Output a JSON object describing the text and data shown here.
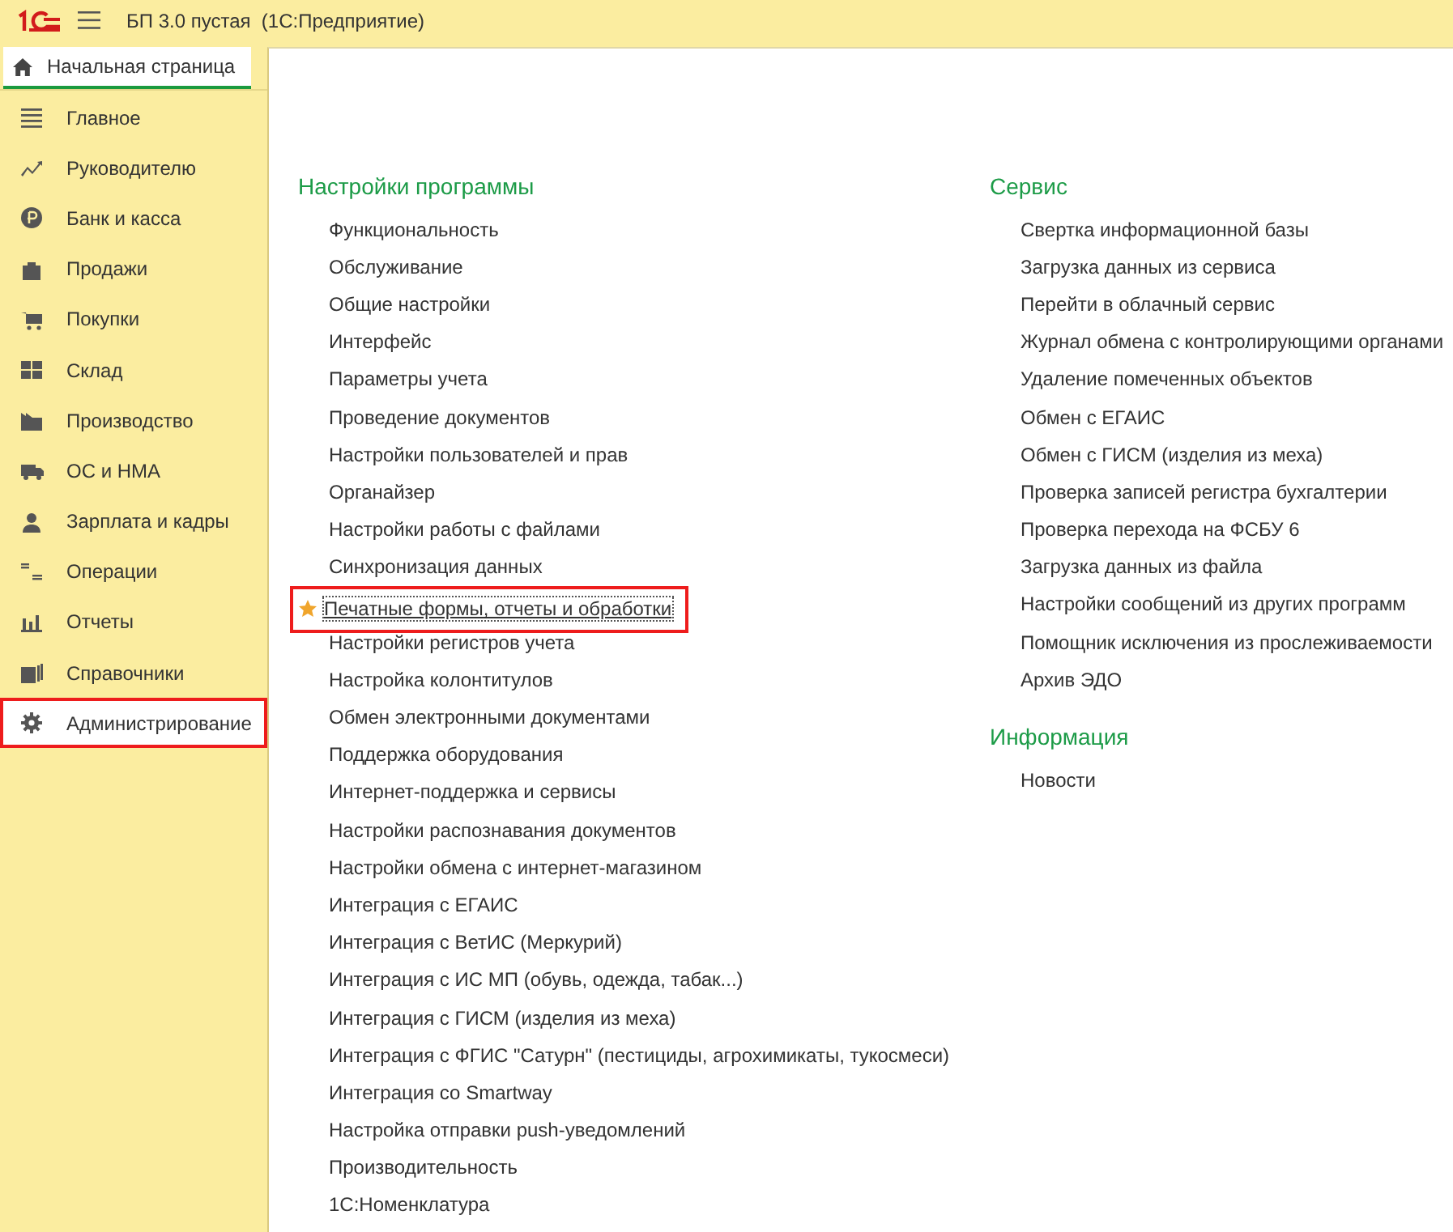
{
  "window": {
    "title": "БП 3.0 пустая  (1С:Предприятие)"
  },
  "tabs": [
    {
      "label": "Начальная страница",
      "selected": true
    }
  ],
  "sidebar": {
    "items": [
      {
        "label": "Главное",
        "selected": false,
        "highlighted": false
      },
      {
        "label": "Руководителю",
        "selected": false,
        "highlighted": false
      },
      {
        "label": "Банк и касса",
        "selected": false,
        "highlighted": false
      },
      {
        "label": "Продажи",
        "selected": false,
        "highlighted": false
      },
      {
        "label": "Покупки",
        "selected": false,
        "highlighted": false
      },
      {
        "label": "Склад",
        "selected": false,
        "highlighted": false
      },
      {
        "label": "Производство",
        "selected": false,
        "highlighted": false
      },
      {
        "label": "ОС и НМА",
        "selected": false,
        "highlighted": false
      },
      {
        "label": "Зарплата и кадры",
        "selected": false,
        "highlighted": false
      },
      {
        "label": "Операции",
        "selected": false,
        "highlighted": false
      },
      {
        "label": "Отчеты",
        "selected": false,
        "highlighted": false
      },
      {
        "label": "Справочники",
        "selected": false,
        "highlighted": false
      },
      {
        "label": "Администрирование",
        "selected": true,
        "highlighted": true
      }
    ]
  },
  "columns": [
    {
      "sections": [
        {
          "title": "Настройки программы",
          "items": [
            {
              "label": "Функциональность",
              "favorite": false,
              "highlighted": false
            },
            {
              "label": "Обслуживание",
              "favorite": false,
              "highlighted": false
            },
            {
              "label": "Общие настройки",
              "favorite": false,
              "highlighted": false
            },
            {
              "label": "Интерфейс",
              "favorite": false,
              "highlighted": false
            },
            {
              "label": "Параметры учета",
              "favorite": false,
              "highlighted": false
            },
            {
              "label": "Проведение документов",
              "favorite": false,
              "highlighted": false
            },
            {
              "label": "Настройки пользователей и прав",
              "favorite": false,
              "highlighted": false
            },
            {
              "label": "Органайзер",
              "favorite": false,
              "highlighted": false
            },
            {
              "label": "Настройки работы с файлами",
              "favorite": false,
              "highlighted": false
            },
            {
              "label": "Синхронизация данных",
              "favorite": false,
              "highlighted": false
            },
            {
              "label": "Печатные формы, отчеты и обработки",
              "favorite": true,
              "highlighted": true
            },
            {
              "label": "Настройки регистров учета",
              "favorite": false,
              "highlighted": false
            },
            {
              "label": "Настройка колонтитулов",
              "favorite": false,
              "highlighted": false
            },
            {
              "label": "Обмен электронными документами",
              "favorite": false,
              "highlighted": false
            },
            {
              "label": "Поддержка оборудования",
              "favorite": false,
              "highlighted": false
            },
            {
              "label": "Интернет-поддержка и сервисы",
              "favorite": false,
              "highlighted": false
            },
            {
              "label": "Настройки распознавания документов",
              "favorite": false,
              "highlighted": false
            },
            {
              "label": "Настройки обмена с интернет-магазином",
              "favorite": false,
              "highlighted": false
            },
            {
              "label": "Интеграция с ЕГАИС",
              "favorite": false,
              "highlighted": false
            },
            {
              "label": "Интеграция с ВетИС (Меркурий)",
              "favorite": false,
              "highlighted": false
            },
            {
              "label": "Интеграция с ИС МП (обувь, одежда, табак...)",
              "favorite": false,
              "highlighted": false
            },
            {
              "label": "Интеграция с ГИСМ (изделия из меха)",
              "favorite": false,
              "highlighted": false
            },
            {
              "label": "Интеграция с ФГИС \"Сатурн\" (пестициды, агрохимикаты, тукосмеси)",
              "favorite": false,
              "highlighted": false
            },
            {
              "label": "Интеграция со Smartway",
              "favorite": false,
              "highlighted": false
            },
            {
              "label": "Настройка отправки push-уведомлений",
              "favorite": false,
              "highlighted": false
            },
            {
              "label": "Производительность",
              "favorite": false,
              "highlighted": false
            },
            {
              "label": "1С:Номенклатура",
              "favorite": false,
              "highlighted": false
            }
          ]
        }
      ]
    },
    {
      "sections": [
        {
          "title": "Сервис",
          "items": [
            {
              "label": "Свертка информационной базы",
              "favorite": false,
              "highlighted": false
            },
            {
              "label": "Загрузка данных из сервиса",
              "favorite": false,
              "highlighted": false
            },
            {
              "label": "Перейти в облачный сервис",
              "favorite": false,
              "highlighted": false
            },
            {
              "label": "Журнал обмена с контролирующими органами",
              "favorite": false,
              "highlighted": false
            },
            {
              "label": "Удаление помеченных объектов",
              "favorite": false,
              "highlighted": false
            },
            {
              "label": "Обмен с ЕГАИС",
              "favorite": false,
              "highlighted": false
            },
            {
              "label": "Обмен с ГИСМ (изделия из меха)",
              "favorite": false,
              "highlighted": false
            },
            {
              "label": "Проверка записей регистра бухгалтерии",
              "favorite": false,
              "highlighted": false
            },
            {
              "label": "Проверка перехода на ФСБУ 6",
              "favorite": false,
              "highlighted": false
            },
            {
              "label": "Загрузка данных из файла",
              "favorite": false,
              "highlighted": false
            },
            {
              "label": "Настройки сообщений из других программ",
              "favorite": false,
              "highlighted": false
            },
            {
              "label": "Помощник исключения из прослеживаемости",
              "favorite": false,
              "highlighted": false
            },
            {
              "label": "Архив ЭДО",
              "favorite": false,
              "highlighted": false
            }
          ]
        },
        {
          "title": "Информация",
          "items": [
            {
              "label": "Новости",
              "favorite": false,
              "highlighted": false
            }
          ]
        }
      ]
    }
  ]
}
